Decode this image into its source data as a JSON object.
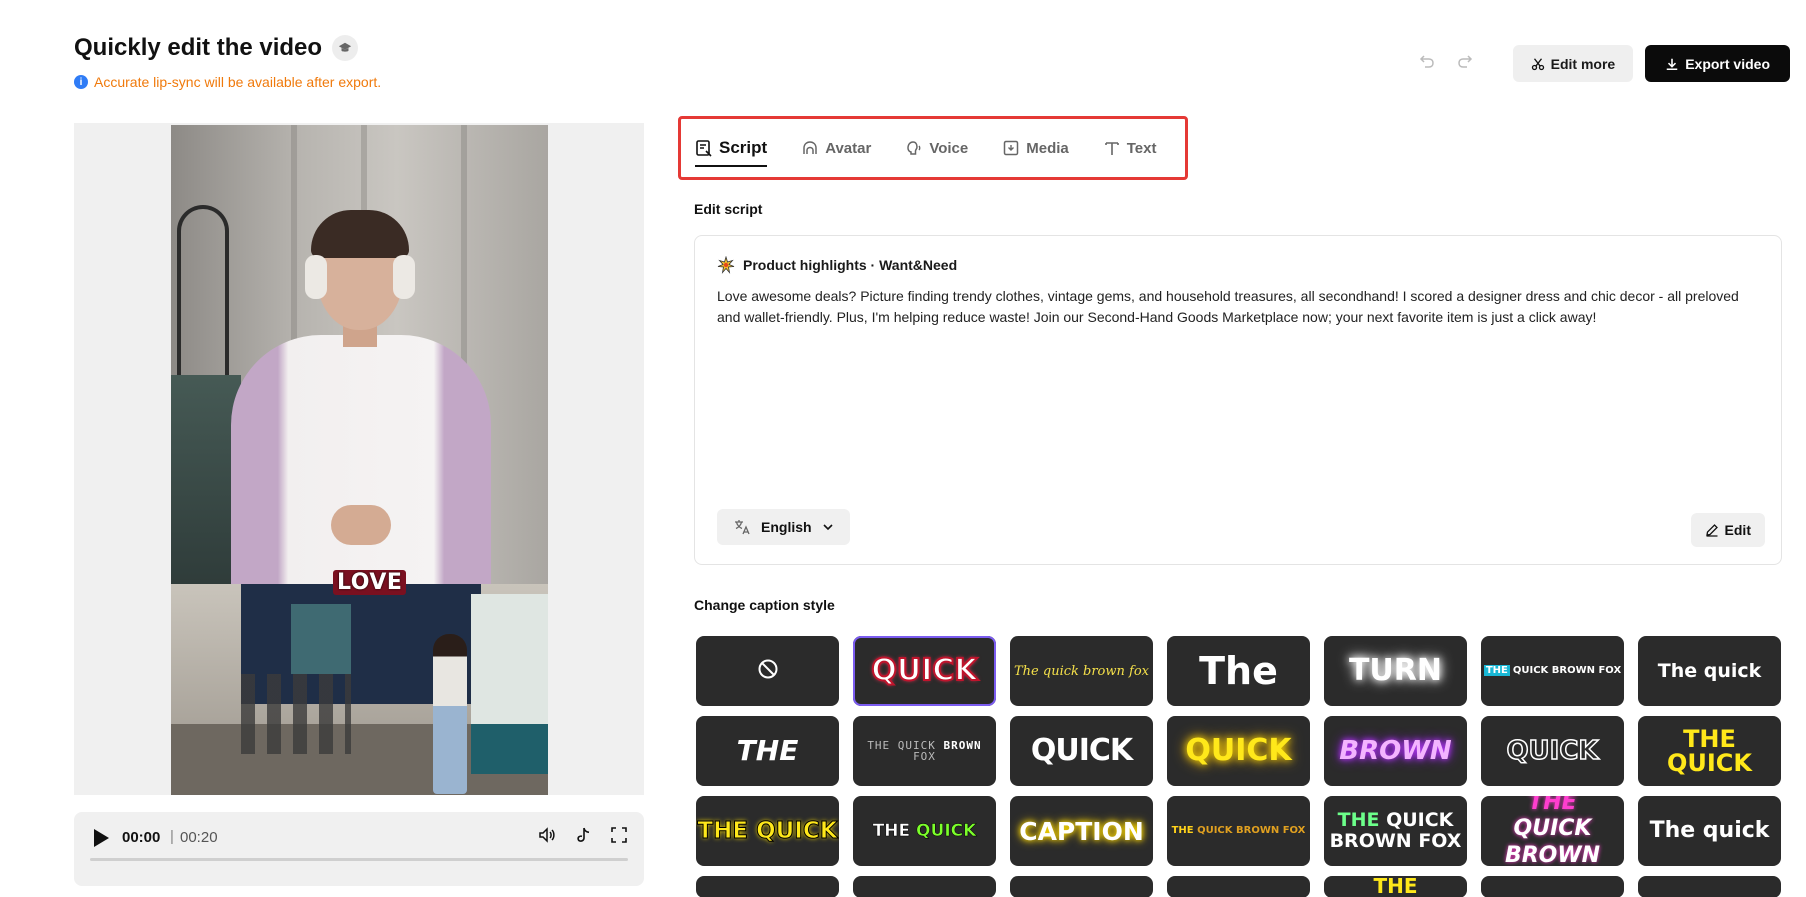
{
  "header": {
    "title": "Quickly edit the video",
    "notice": "Accurate lip-sync will be available after export.",
    "edit_more": "Edit more",
    "export": "Export video"
  },
  "video": {
    "caption_word": "LOVE",
    "current_time": "00:00",
    "separator": "|",
    "total_time": "00:20",
    "progress": 0
  },
  "tabs": [
    {
      "label": "Script",
      "active": true
    },
    {
      "label": "Avatar",
      "active": false
    },
    {
      "label": "Voice",
      "active": false
    },
    {
      "label": "Media",
      "active": false
    },
    {
      "label": "Text",
      "active": false
    }
  ],
  "script": {
    "section_label": "Edit script",
    "title": "Product highlights · Want&Need",
    "body": "Love awesome deals? Picture finding trendy clothes, vintage gems, and household treasures, all secondhand! I scored a designer dress and chic decor - all preloved and wallet-friendly. Plus, I'm helping reduce waste! Join our Second-Hand Goods Marketplace now; your next favorite item is just a click away!",
    "language": "English",
    "edit_label": "Edit"
  },
  "captions": {
    "section_label": "Change caption style",
    "styles": [
      {
        "text": "",
        "kind": "none"
      },
      {
        "text": "QUICK",
        "kind": "red-outline",
        "selected": true
      },
      {
        "text": "The quick brown fox",
        "kind": "yellow-italic"
      },
      {
        "text": "The",
        "kind": "white-big"
      },
      {
        "text": "TURN",
        "kind": "white-glow"
      },
      {
        "text": "THE QUICK BROWN FOX",
        "kind": "cyan-box"
      },
      {
        "text": "The quick",
        "kind": "white-bold"
      },
      {
        "text": "THE",
        "kind": "white-italic"
      },
      {
        "text": "THE QUICK BROWN FOX",
        "kind": "gray-mono"
      },
      {
        "text": "QUICK",
        "kind": "white-condensed"
      },
      {
        "text": "QUICK",
        "kind": "yellow-glow"
      },
      {
        "text": "BROWN",
        "kind": "purple-glow"
      },
      {
        "text": "QUICK",
        "kind": "outline"
      },
      {
        "text": "THE QUICK",
        "kind": "yellow-bold"
      },
      {
        "text": "THE QUICK",
        "kind": "yellow-black-outline"
      },
      {
        "text": "THE QUICK",
        "kind": "green-black"
      },
      {
        "text": "CAPTION",
        "kind": "yellow-white"
      },
      {
        "text": "THE QUICK BROWN FOX",
        "kind": "orange-small"
      },
      {
        "text": "THE QUICK BROWN FOX",
        "kind": "green-white-two-line"
      },
      {
        "text": "THE QUICK BROWN",
        "kind": "pink-white-stack"
      },
      {
        "text": "The quick",
        "kind": "white-plain"
      },
      {
        "text": "",
        "kind": "partial"
      },
      {
        "text": "",
        "kind": "partial"
      },
      {
        "text": "",
        "kind": "partial"
      },
      {
        "text": "",
        "kind": "partial"
      },
      {
        "text": "THE",
        "kind": "partial-yellow"
      },
      {
        "text": "",
        "kind": "partial"
      },
      {
        "text": "",
        "kind": "partial"
      }
    ]
  }
}
